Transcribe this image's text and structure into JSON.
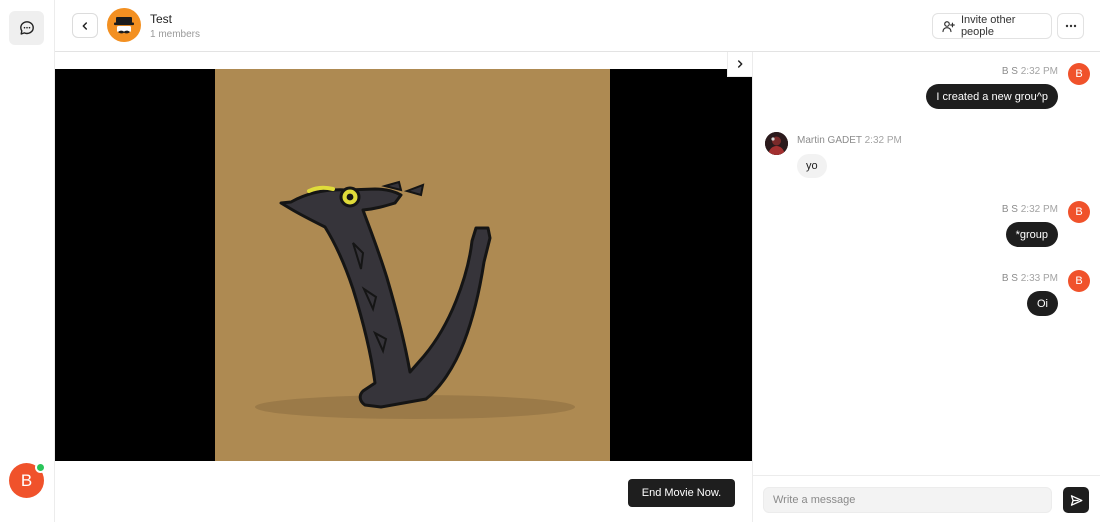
{
  "header": {
    "group_name": "Test",
    "members": "1 members",
    "invite_label": "Invite other people"
  },
  "rail": {
    "user_initial": "B"
  },
  "player": {
    "end_label": "End Movie Now."
  },
  "messages": [
    {
      "sender": "B S",
      "time": "2:32 PM",
      "text": "I created a new grou^p",
      "avatar": "B",
      "mine": true
    },
    {
      "sender": "Martin GADET",
      "time": "2:32 PM",
      "text": "yo",
      "mine": false
    },
    {
      "sender": "B S",
      "time": "2:32 PM",
      "text": "*group",
      "avatar": "B",
      "mine": true
    },
    {
      "sender": "B S",
      "time": "2:33 PM",
      "text": "Oi",
      "avatar": "B",
      "mine": true
    }
  ],
  "composer": {
    "placeholder": "Write a message"
  },
  "colors": {
    "accent_avatar": "#f0522b",
    "group_avatar": "#f39021",
    "online": "#29c55a",
    "dark_bubble": "#1e1e1e"
  }
}
